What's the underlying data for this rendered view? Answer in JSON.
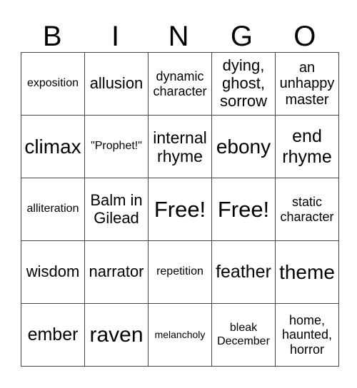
{
  "header": [
    "B",
    "I",
    "N",
    "G",
    "O"
  ],
  "rows": [
    [
      "exposition",
      "allusion",
      "dynamic character",
      "dying, ghost, sorrow",
      "an unhappy master"
    ],
    [
      "climax",
      "\"Prophet!\"",
      "internal rhyme",
      "ebony",
      "end rhyme"
    ],
    [
      "alliteration",
      "Balm in Gilead",
      "Free!",
      "Free!",
      "static character"
    ],
    [
      "wisdom",
      "narrator",
      "repetition",
      "feather",
      "theme"
    ],
    [
      "ember",
      "raven",
      "melancholy",
      "bleak December",
      "home, haunted, horror"
    ]
  ]
}
